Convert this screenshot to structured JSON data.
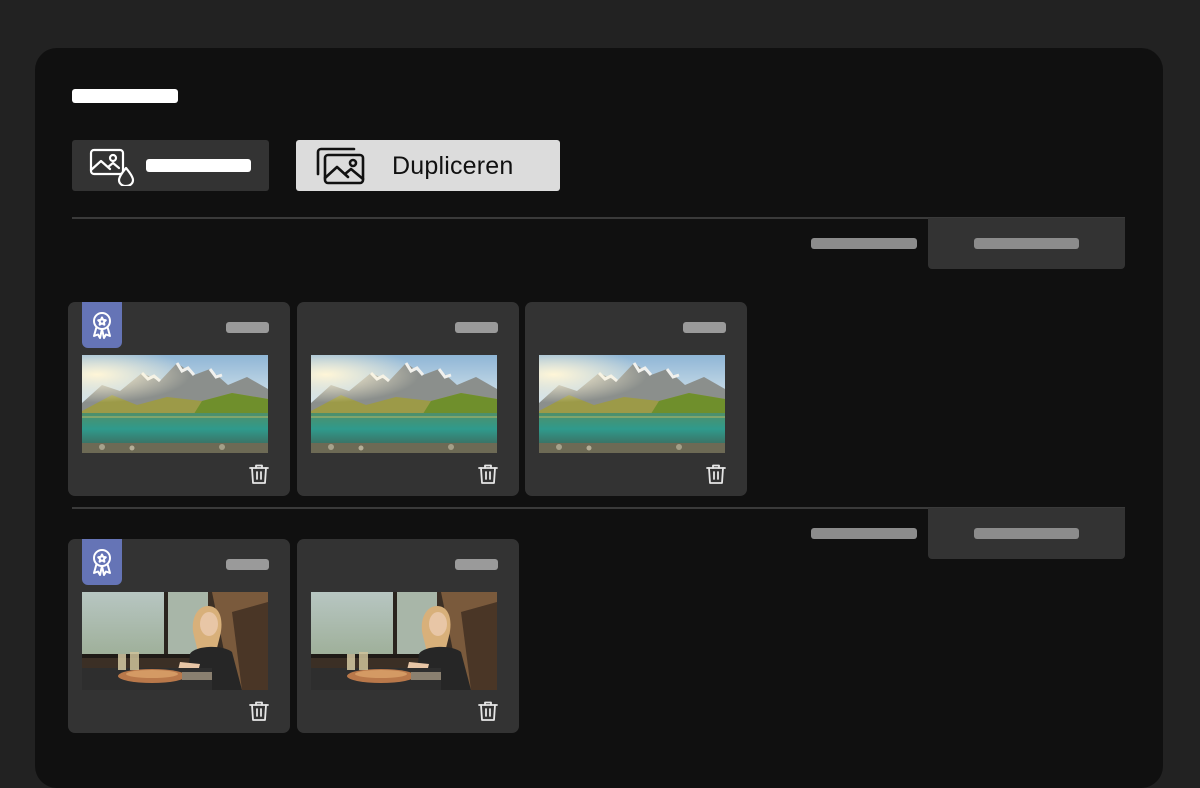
{
  "toolbar": {
    "duplicate_label": "Dupliceren"
  },
  "icons": {
    "watermark": "image-droplet-icon",
    "duplicate": "images-stack-icon",
    "badge": "award-ribbon-icon",
    "delete": "trash-icon"
  },
  "colors": {
    "badge": "#6574b6",
    "duplicate_button_bg": "#dcdcdc",
    "panel_bg": "#101010",
    "card_bg": "#333333"
  },
  "groups": [
    {
      "images": [
        {
          "thumbnail": "mountain-lake",
          "is_best": true
        },
        {
          "thumbnail": "mountain-lake",
          "is_best": false
        },
        {
          "thumbnail": "mountain-lake",
          "is_best": false
        }
      ]
    },
    {
      "images": [
        {
          "thumbnail": "woman-on-train",
          "is_best": true
        },
        {
          "thumbnail": "woman-on-train",
          "is_best": false
        }
      ]
    }
  ]
}
